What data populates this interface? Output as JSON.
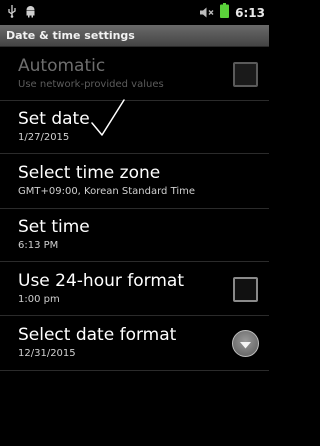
{
  "status_bar": {
    "time": "6:13",
    "icons": [
      "usb-icon",
      "android-icon",
      "mute-icon",
      "battery-icon"
    ]
  },
  "title": "Date & time settings",
  "settings": {
    "automatic": {
      "title": "Automatic",
      "subtitle": "Use network-provided values",
      "checked": false,
      "enabled": false
    },
    "set_date": {
      "title": "Set date",
      "subtitle": "1/27/2015"
    },
    "time_zone": {
      "title": "Select time zone",
      "subtitle": "GMT+09:00, Korean Standard Time"
    },
    "set_time": {
      "title": "Set time",
      "subtitle": "6:13 PM"
    },
    "format_24": {
      "title": "Use 24-hour format",
      "subtitle": "1:00 pm",
      "checked": false
    },
    "date_format": {
      "title": "Select date format",
      "subtitle": "12/31/2015"
    }
  },
  "colors": {
    "battery": "#5ad13a",
    "title_bar": "#555555",
    "background": "#000000"
  }
}
